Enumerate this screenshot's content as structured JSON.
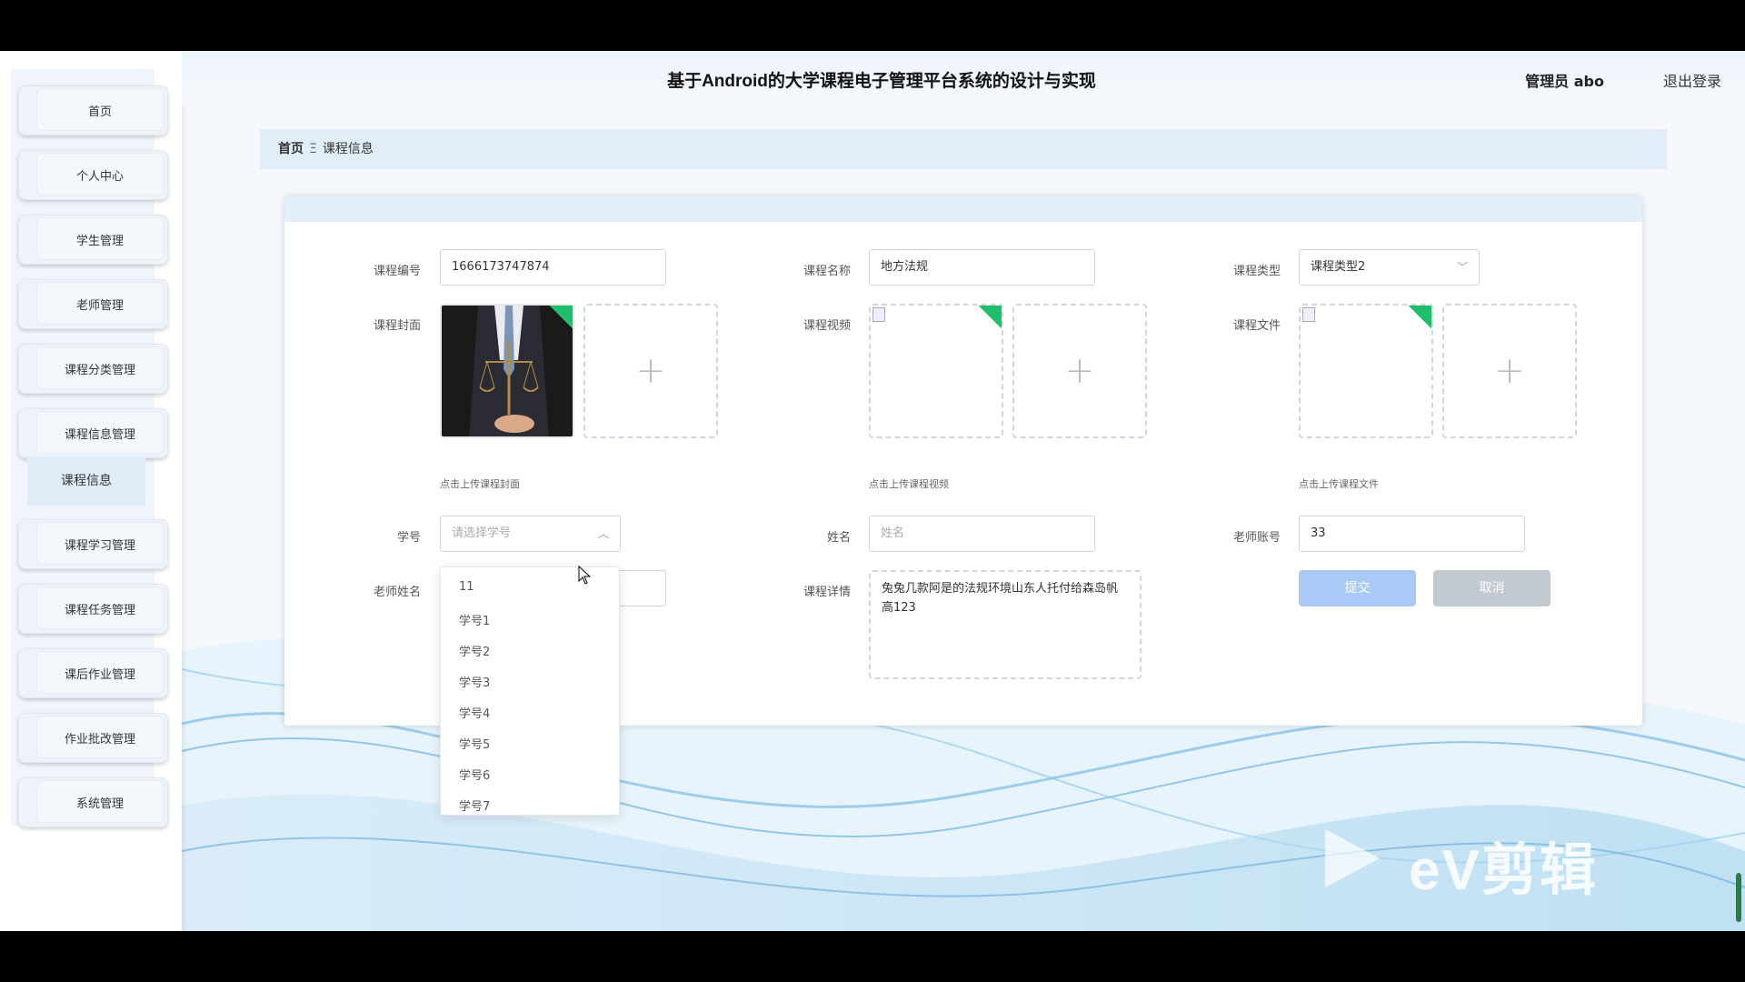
{
  "app": {
    "title": "基于Android的大学课程电子管理平台系统的设计与实现",
    "user": "管理员 abo",
    "logout": "退出登录"
  },
  "sidebar": {
    "items": [
      {
        "label": "首页"
      },
      {
        "label": "个人中心"
      },
      {
        "label": "学生管理"
      },
      {
        "label": "老师管理"
      },
      {
        "label": "课程分类管理"
      },
      {
        "label": "课程信息管理"
      },
      {
        "label": "课程学习管理"
      },
      {
        "label": "课程任务管理"
      },
      {
        "label": "课后作业管理"
      },
      {
        "label": "作业批改管理"
      },
      {
        "label": "系统管理"
      }
    ],
    "sub_item": "课程信息"
  },
  "breadcrumb": {
    "home": "首页",
    "separator": "Ξ",
    "current": "课程信息"
  },
  "form": {
    "course_no_label": "课程编号",
    "course_no_value": "1666173747874",
    "course_name_label": "课程名称",
    "course_name_value": "地方法规",
    "course_type_label": "课程类型",
    "course_type_value": "课程类型2",
    "cover_label": "课程封面",
    "cover_hint": "点击上传课程封面",
    "video_label": "课程视频",
    "video_hint": "点击上传课程视频",
    "file_label": "课程文件",
    "file_hint": "点击上传课程文件",
    "student_no_label": "学号",
    "student_no_placeholder": "请选择学号",
    "name_label": "姓名",
    "name_placeholder": "姓名",
    "teacher_account_label": "老师账号",
    "teacher_account_value": "33",
    "teacher_name_label": "老师姓名",
    "detail_label": "课程详情",
    "detail_value": "兔兔几款阿是的法规环境山东人托付给森岛帆高123",
    "submit": "提交",
    "cancel": "取消"
  },
  "dropdown": {
    "options": [
      "11",
      "学号1",
      "学号2",
      "学号3",
      "学号4",
      "学号5",
      "学号6",
      "学号7"
    ]
  },
  "watermark": "eV剪辑",
  "colors": {
    "accent": "#a9c9f7",
    "cancel": "#c3c9d1",
    "corner": "#1fbe6a",
    "breadcrumb_bg": "#e1edf9"
  }
}
